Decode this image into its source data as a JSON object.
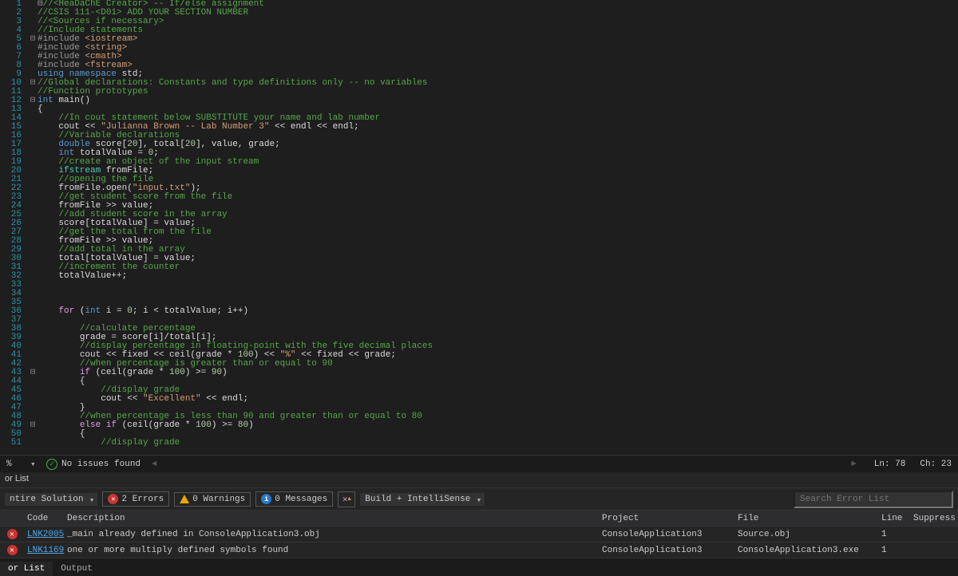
{
  "code_lines": [
    {
      "n": 1,
      "fold": "",
      "html": "<span class='c-gray'>⊟</span><span class='c-green'>//&lt;HeaDaChE Creator&gt; -- If/else assignment</span>"
    },
    {
      "n": 2,
      "fold": "",
      "html": "<span class='c-green'>//CSIS 111-&lt;D01&gt; ADD YOUR SECTION NUMBER</span>"
    },
    {
      "n": 3,
      "fold": "",
      "html": "<span class='c-green'>//&lt;Sources if necessary&gt;</span>"
    },
    {
      "n": 4,
      "fold": "",
      "html": "<span class='c-green'>//Include statements</span>"
    },
    {
      "n": 5,
      "fold": "⊟",
      "html": "<span class='c-gray'>#include</span> <span class='c-str'>&lt;iostream&gt;</span>"
    },
    {
      "n": 6,
      "fold": "",
      "html": "<span class='c-gray'>#include</span> <span class='c-str'>&lt;string&gt;</span>"
    },
    {
      "n": 7,
      "fold": "",
      "html": "<span class='c-gray'>#include</span> <span class='c-str'>&lt;cmath&gt;</span>"
    },
    {
      "n": 8,
      "fold": "",
      "html": "<span class='c-gray'>#include</span> <span class='c-str'>&lt;fstream&gt;</span>"
    },
    {
      "n": 9,
      "fold": "",
      "html": "<span class='c-blue'>using namespace</span> <span class='c-white'>std;</span>"
    },
    {
      "n": 10,
      "fold": "⊟",
      "html": "<span class='c-green'>//Global declarations: Constants and type definitions only -- no variables</span>"
    },
    {
      "n": 11,
      "fold": "",
      "html": "<span class='c-green'>//Function prototypes</span>"
    },
    {
      "n": 12,
      "fold": "⊟",
      "html": "<span class='c-blue'>int</span> <span class='c-white'>main()</span>"
    },
    {
      "n": 13,
      "fold": "",
      "html": "<span class='c-white'>{</span>"
    },
    {
      "n": 14,
      "fold": "",
      "html": "    <span class='c-green'>//In cout statement below SUBSTITUTE your name and lab number</span>"
    },
    {
      "n": 15,
      "fold": "",
      "html": "    <span class='c-white'>cout &lt;&lt; </span><span class='c-str'>\"Julianna Brown -- Lab Number 3\"</span><span class='c-white'> &lt;&lt; endl &lt;&lt; endl;</span>"
    },
    {
      "n": 16,
      "fold": "",
      "html": "    <span class='c-green'>//Variable declarations</span>"
    },
    {
      "n": 17,
      "fold": "",
      "html": "    <span class='c-blue'>double</span> <span class='c-white'>score[</span><span class='c-num'>20</span><span class='c-white'>], total[</span><span class='c-num'>20</span><span class='c-white'>], value, grade;</span>"
    },
    {
      "n": 18,
      "fold": "",
      "html": "    <span class='c-blue'>int</span> <span class='c-white'>totalValue = </span><span class='c-num'>0</span><span class='c-white'>;</span>"
    },
    {
      "n": 19,
      "fold": "",
      "html": "    <span class='c-green'>//create an object of the input stream</span>"
    },
    {
      "n": 20,
      "fold": "",
      "html": "    <span class='c-type'>ifstream</span> <span class='c-white'>fromFile;</span>"
    },
    {
      "n": 21,
      "fold": "",
      "html": "    <span class='c-green'>//opening the file</span>"
    },
    {
      "n": 22,
      "fold": "",
      "html": "    <span class='c-white'>fromFile.open(</span><span class='c-str'>\"input.txt\"</span><span class='c-white'>);</span>"
    },
    {
      "n": 23,
      "fold": "",
      "html": "    <span class='c-green'>//get student score from the file</span>"
    },
    {
      "n": 24,
      "fold": "",
      "html": "    <span class='c-white'>fromFile &gt;&gt; value;</span>"
    },
    {
      "n": 25,
      "fold": "",
      "html": "    <span class='c-green'>//add student score in the array</span>"
    },
    {
      "n": 26,
      "fold": "",
      "html": "    <span class='c-white'>score[totalValue] = value;</span>"
    },
    {
      "n": 27,
      "fold": "",
      "html": "    <span class='c-green'>//get the total from the file</span>"
    },
    {
      "n": 28,
      "fold": "",
      "html": "    <span class='c-white'>fromFile &gt;&gt; value;</span>"
    },
    {
      "n": 29,
      "fold": "",
      "html": "    <span class='c-green'>//add total in the array</span>"
    },
    {
      "n": 30,
      "fold": "",
      "html": "    <span class='c-white'>total[totalValue] = value;</span>"
    },
    {
      "n": 31,
      "fold": "",
      "html": "    <span class='c-green'>//increment the counter</span>"
    },
    {
      "n": 32,
      "fold": "",
      "html": "    <span class='c-white'>totalValue++;</span>"
    },
    {
      "n": 33,
      "fold": "",
      "html": ""
    },
    {
      "n": 34,
      "fold": "",
      "html": ""
    },
    {
      "n": 35,
      "fold": "",
      "html": ""
    },
    {
      "n": 36,
      "fold": "",
      "html": "    <span class='c-kw'>for</span> <span class='c-white'>(</span><span class='c-blue'>int</span><span class='c-white'> i = </span><span class='c-num'>0</span><span class='c-white'>; i &lt; totalValue; i++)</span>"
    },
    {
      "n": 37,
      "fold": "",
      "html": ""
    },
    {
      "n": 38,
      "fold": "",
      "html": "        <span class='c-green'>//calculate percentage</span>"
    },
    {
      "n": 39,
      "fold": "",
      "html": "        <span class='c-white'>grade = score[i]/total[i];</span>"
    },
    {
      "n": 40,
      "fold": "",
      "html": "        <span class='c-green'>//display percentage in floating-point with the five decimal places</span>"
    },
    {
      "n": 41,
      "fold": "",
      "html": "        <span class='c-white'>cout &lt;&lt; fixed &lt;&lt; ceil(grade * </span><span class='c-num'>100</span><span class='c-white'>) &lt;&lt; </span><span class='c-str'>\"%\"</span><span class='c-white'> &lt;&lt; fixed &lt;&lt; grade;</span>"
    },
    {
      "n": 42,
      "fold": "",
      "html": "        <span class='c-green'>//when percentage is greater than or equal to 90</span>"
    },
    {
      "n": 43,
      "fold": "⊟",
      "html": "        <span class='c-kw'>if</span> <span class='c-white'>(ceil(grade * </span><span class='c-num'>100</span><span class='c-white'>) &gt;= </span><span class='c-num'>90</span><span class='c-white'>)</span>"
    },
    {
      "n": 44,
      "fold": "",
      "html": "        <span class='c-white'>{</span>"
    },
    {
      "n": 45,
      "fold": "",
      "html": "            <span class='c-green'>//display grade</span>"
    },
    {
      "n": 46,
      "fold": "",
      "html": "            <span class='c-white'>cout &lt;&lt; </span><span class='c-str'>\"Excellent\"</span><span class='c-white'> &lt;&lt; endl;</span>"
    },
    {
      "n": 47,
      "fold": "",
      "html": "        <span class='c-white'>}</span>"
    },
    {
      "n": 48,
      "fold": "",
      "html": "        <span class='c-green'>//when percentage is less than 90 and greater than or equal to 80</span>"
    },
    {
      "n": 49,
      "fold": "⊟",
      "html": "        <span class='c-kw'>else if</span> <span class='c-white'>(ceil(grade * </span><span class='c-num'>100</span><span class='c-white'>) &gt;= </span><span class='c-num'>80</span><span class='c-white'>)</span>"
    },
    {
      "n": 50,
      "fold": "",
      "html": "        <span class='c-white'>{</span>"
    },
    {
      "n": 51,
      "fold": "",
      "html": "            <span class='c-green'>//display grade</span>"
    }
  ],
  "status": {
    "pct": "%",
    "issues": "No issues found",
    "ln": "Ln: 78",
    "ch": "Ch: 23"
  },
  "panel_title": "or List",
  "toolbar": {
    "scope": "ntire Solution",
    "errors": "2 Errors",
    "warnings": "0 Warnings",
    "messages": "0 Messages",
    "build": "Build + IntelliSense",
    "search_placeholder": "Search Error List"
  },
  "table": {
    "headers": {
      "code": "Code",
      "desc": "Description",
      "proj": "Project",
      "file": "File",
      "line": "Line",
      "supp": "Suppress"
    },
    "rows": [
      {
        "code": "LNK2005",
        "desc": "_main already defined in ConsoleApplication3.obj",
        "proj": "ConsoleApplication3",
        "file": "Source.obj",
        "line": "1"
      },
      {
        "code": "LNK1169",
        "desc": "one or more multiply defined symbols found",
        "proj": "ConsoleApplication3",
        "file": "ConsoleApplication3.exe",
        "line": "1"
      }
    ]
  },
  "tabs": {
    "a": "or List",
    "b": "Output"
  }
}
